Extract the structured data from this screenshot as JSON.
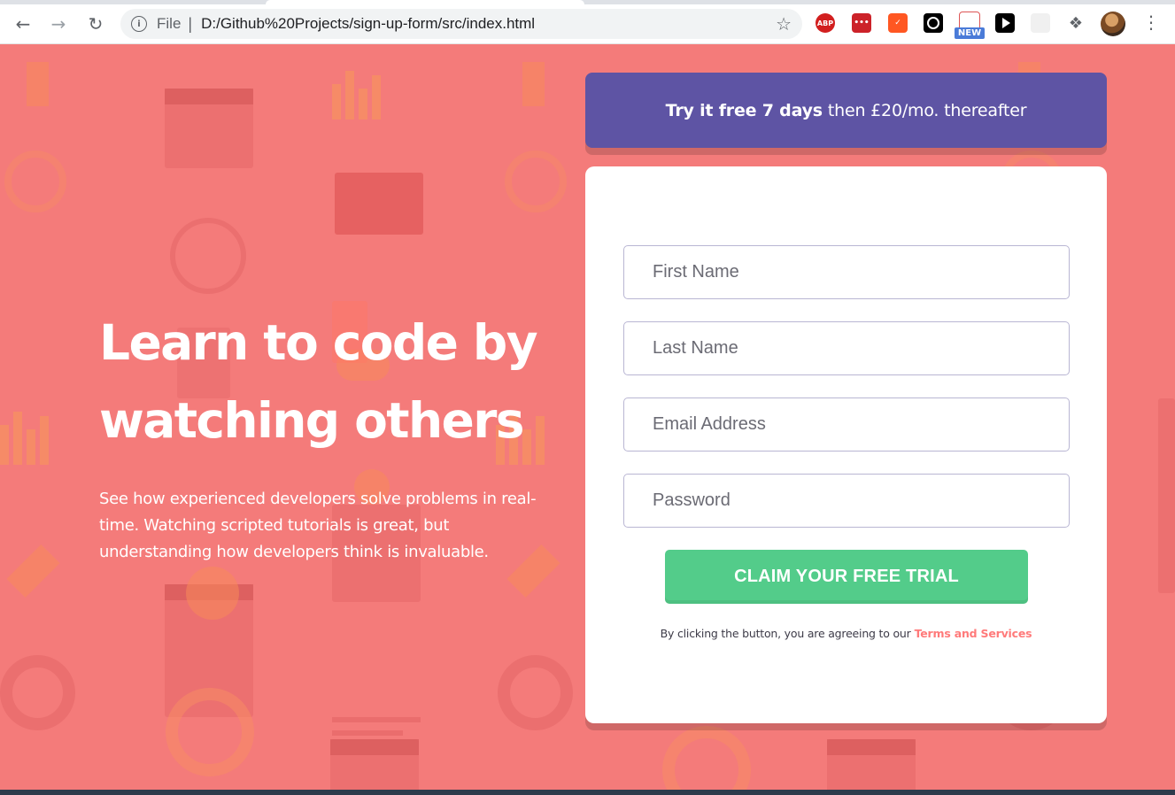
{
  "browser": {
    "scheme_label": "File",
    "separator": "|",
    "url": "D:/Github%20Projects/sign-up-form/src/index.html",
    "extensions": {
      "abp_label": "ABP",
      "lastpass_label": "•••",
      "new_badge": "NEW"
    },
    "icons": [
      "back-arrow-icon",
      "forward-arrow-icon",
      "reload-icon",
      "info-icon",
      "star-icon",
      "puzzle-icon",
      "menu-icon"
    ]
  },
  "hero": {
    "title": "Learn to code by watching others",
    "description": "See how experienced developers solve problems in real-time. Watching scripted tutorials is great, but understanding how developers think is invaluable."
  },
  "promo": {
    "bold_text": "Try it free 7 days",
    "text": "then £20/mo. thereafter"
  },
  "form": {
    "first_name_placeholder": "First Name",
    "last_name_placeholder": "Last Name",
    "email_placeholder": "Email Address",
    "password_placeholder": "Password",
    "submit_label": "CLAIM YOUR FREE TRIAL",
    "terms_text": "By clicking the button, you are agreeing to our",
    "terms_link": "Terms and Services"
  },
  "colors": {
    "background": "#f47b7a",
    "promo": "#5e54a4",
    "cta": "#53cc8a",
    "link": "#ff7a7a"
  }
}
